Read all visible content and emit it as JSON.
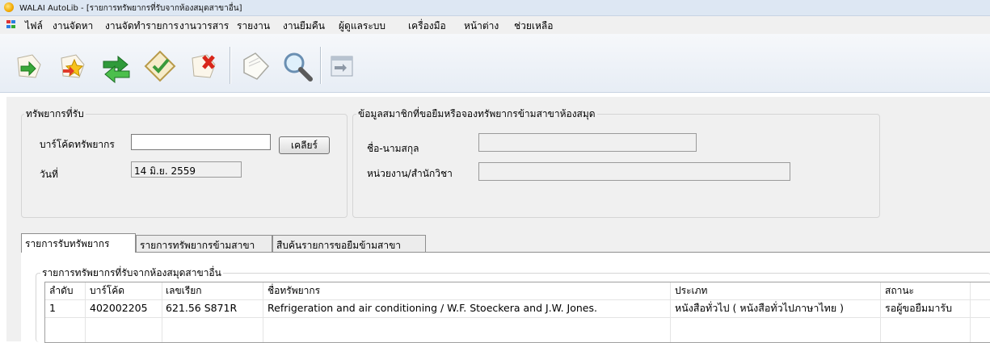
{
  "window": {
    "title": "WALAI AutoLib - [รายการทรัพยากรที่รับจากห้องสมุดสาขาอื่น]"
  },
  "menu": [
    "ไฟล์",
    "งานจัดหา",
    "งานจัดทำรายการ",
    "งานวารสาร",
    "รายงาน",
    "งานยืมคืน",
    "ผู้ดูแลระบบ",
    "เครื่องมือ",
    "หน้าต่าง",
    "ช่วยเหลือ"
  ],
  "toolbar": [
    "new-icon",
    "favorite-icon",
    "exchange-icon",
    "checkmark-icon",
    "delete-icon",
    "document-icon",
    "search-icon",
    "export-icon"
  ],
  "received": {
    "group_title": "ทรัพยากรที่รับ",
    "barcode_label": "บาร์โค้ดทรัพยากร",
    "barcode_value": "",
    "clear_button": "เคลียร์",
    "date_label": "วันที่",
    "date_value": "14 มิ.ย. 2559"
  },
  "member": {
    "group_title": "ข้อมูลสมาชิกที่ขอยืมหรือจองทรัพยากรข้ามสาขาห้องสมุด",
    "name_label": "ชื่อ-นามสกุล",
    "name_value": "",
    "dept_label": "หน่วยงาน/สำนักวิชา",
    "dept_value": ""
  },
  "tabs": [
    "รายการรับทรัพยากร",
    "รายการทรัพยากรข้ามสาขา",
    "สืบค้นรายการขอยืมข้ามสาขา"
  ],
  "list": {
    "group_title": "รายการทรัพยากรที่รับจากห้องสมุดสาขาอื่น",
    "columns": [
      "ลำดับ",
      "บาร์โค้ด",
      "เลขเรียก",
      "ชื่อทรัพยากร",
      "ประเภท",
      "สถานะ"
    ],
    "rows": [
      [
        "1",
        "402002205",
        "621.56 S871R",
        "Refrigeration and air conditioning / W.F. Stoeckera and J.W. Jones.",
        "หนังสือทั่วไป ( หนังสือทั่วไปภาษาไทย )",
        "รอผู้ขอยืมมารับ"
      ]
    ]
  },
  "colors": {
    "titlebar": "#dde7f3",
    "panel": "#f0f0f0",
    "accent": "#f2a900"
  }
}
